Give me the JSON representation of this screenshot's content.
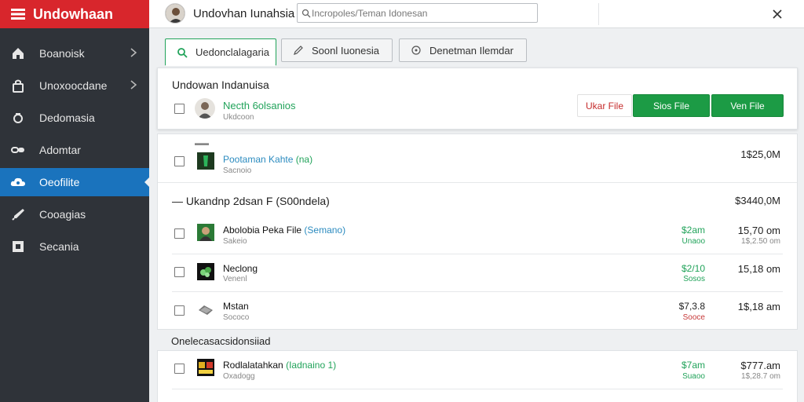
{
  "app": {
    "brand": "Undowhaan",
    "title": "Undovhan Iunahsia",
    "search_placeholder": "Incropoles/Teman Idonesan"
  },
  "sidebar": {
    "items": [
      {
        "label": "Boanoisk",
        "icon": "home-icon",
        "chevron": true,
        "active": false
      },
      {
        "label": "Unoxoocdane",
        "icon": "lock-icon",
        "chevron": true,
        "active": false
      },
      {
        "label": "Dedomasia",
        "icon": "camera-icon",
        "chevron": false,
        "active": false
      },
      {
        "label": "Adomtar",
        "icon": "link-icon",
        "chevron": false,
        "active": false
      },
      {
        "label": "Oeofilite",
        "icon": "cloud-icon",
        "chevron": false,
        "active": true
      },
      {
        "label": "Cooagias",
        "icon": "brush-icon",
        "chevron": false,
        "active": false
      },
      {
        "label": "Secania",
        "icon": "square-icon",
        "chevron": false,
        "active": false
      }
    ]
  },
  "tabs": [
    {
      "label": "Uedonclalagaria",
      "icon": "search-icon",
      "active": true
    },
    {
      "label": "Soonl Iuonesia",
      "icon": "pencil-icon",
      "active": false
    },
    {
      "label": "Denetman Ilemdar",
      "icon": "circle-icon",
      "active": false
    }
  ],
  "header_panel": {
    "title": "Undowan Indanuisa",
    "user_name": "Necth 6olsanios",
    "user_sub": "Ukdcoon",
    "buttons": {
      "upload": "Ukar File",
      "share": "Sios File",
      "view": "Ven File"
    }
  },
  "files": {
    "first": {
      "name": "Pootaman Kahte",
      "name_hl": "(na)",
      "sub": "Sacnoio",
      "time": "1$25,0M"
    },
    "group_title": "Ukandnp 2dsan F",
    "group_title_hl": "(S00ndela)",
    "group_time": "$3440,0M",
    "rows": [
      {
        "name": "Abolobia Peka File",
        "name_hl": "(Semano)",
        "sub": "Sakeio",
        "amount": "$2am",
        "amount_sub": "Unaoo",
        "amount_sub_color": "green",
        "amount_color": "green",
        "time": "15,70 om",
        "time_sub": "1$,2.50 om"
      },
      {
        "name": "Neclong",
        "name_hl": "",
        "sub": "Venenl",
        "amount": "$2/10",
        "amount_sub": "Sosos",
        "amount_sub_color": "green",
        "amount_color": "green",
        "time": "15,18 om",
        "time_sub": ""
      },
      {
        "name": "Mstan",
        "name_hl": "",
        "sub": "Sococo",
        "amount": "$7,3.8",
        "amount_sub": "Sooce",
        "amount_sub_color": "red",
        "amount_color": "dark",
        "time": "1$,18 am",
        "time_sub": ""
      }
    ]
  },
  "bottom_group": {
    "label": "Onelecasacsidonsiiad",
    "rows": [
      {
        "name": "Rodlalatahkan",
        "name_hl": "(Iadnaino 1)",
        "sub": "Oxadogg",
        "amount": "$7am",
        "amount_sub": "Suaoo",
        "time": "$777.am",
        "time_sub": "1$,28.7 om"
      }
    ]
  }
}
